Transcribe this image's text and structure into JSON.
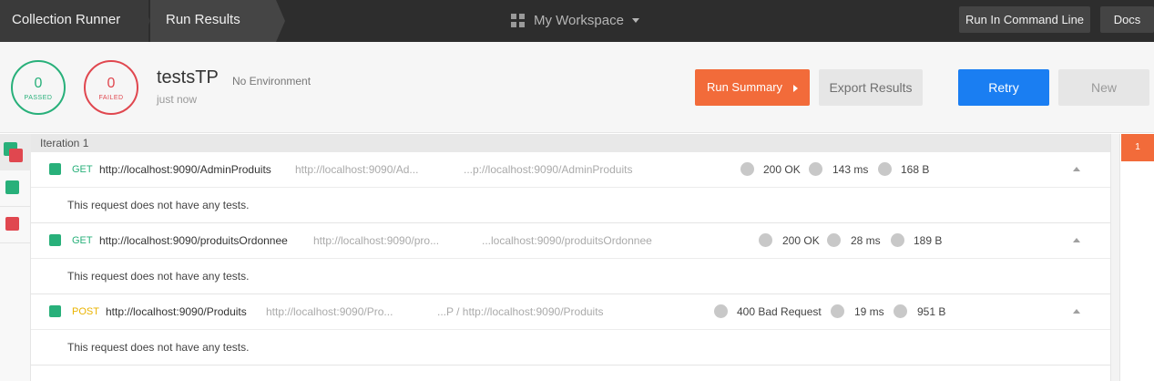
{
  "topbar": {
    "crumbs": [
      "Collection Runner",
      "Run Results"
    ],
    "workspace": "My Workspace",
    "run_cmd_label": "Run In Command Line",
    "docs_label": "Docs"
  },
  "summary": {
    "passed_count": "0",
    "passed_label": "PASSED",
    "failed_count": "0",
    "failed_label": "FAILED",
    "run_name": "testsTP",
    "environment": "No Environment",
    "time": "just now",
    "run_summary_label": "Run Summary",
    "export_label": "Export Results",
    "retry_label": "Retry",
    "new_label": "New"
  },
  "iteration": {
    "label": "Iteration 1",
    "badge": "1"
  },
  "requests": [
    {
      "method": "GET",
      "name": "http://localhost:9090/AdminProduits",
      "url_short": "http://localhost:9090/Ad...",
      "url_full": "...p://localhost:9090/AdminProduits",
      "status": "200 OK",
      "time": "143 ms",
      "size": "168 B",
      "message": "This request does not have any tests."
    },
    {
      "method": "GET",
      "name": "http://localhost:9090/produitsOrdonnee",
      "url_short": "http://localhost:9090/pro...",
      "url_full": "...localhost:9090/produitsOrdonnee",
      "status": "200 OK",
      "time": "28 ms",
      "size": "189 B",
      "message": "This request does not have any tests."
    },
    {
      "method": "POST",
      "name": "http://localhost:9090/Produits",
      "url_short": "http://localhost:9090/Pro...",
      "url_full": "...P / http://localhost:9090/Produits",
      "status": "400 Bad Request",
      "time": "19 ms",
      "size": "951 B",
      "message": "This request does not have any tests."
    }
  ],
  "colors": {
    "pass": "#28b07a",
    "fail": "#e0474f",
    "accent": "#f26b3a",
    "primary": "#1a7ef2"
  }
}
